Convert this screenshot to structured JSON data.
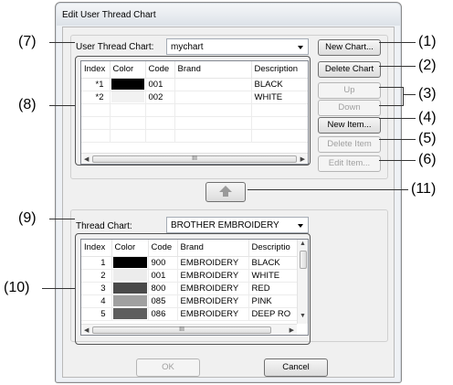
{
  "dialog": {
    "title": "Edit User Thread Chart",
    "user_chart": {
      "label": "User Thread Chart:",
      "selected": "mychart",
      "columns": [
        "Index",
        "Color",
        "Code",
        "Brand",
        "Description"
      ],
      "rows": [
        {
          "index": "*1",
          "color": "#000000",
          "code": "001",
          "brand": "",
          "description": "BLACK"
        },
        {
          "index": "*2",
          "color": "#f2f2f2",
          "code": "002",
          "brand": "",
          "description": "WHITE"
        }
      ]
    },
    "buttons": {
      "new_chart": "New Chart...",
      "delete_chart": "Delete Chart",
      "up": "Up",
      "down": "Down",
      "new_item": "New Item...",
      "delete_item": "Delete Item",
      "edit_item": "Edit Item...",
      "ok": "OK",
      "cancel": "Cancel"
    },
    "thread_chart": {
      "label": "Thread Chart:",
      "selected": "BROTHER EMBROIDERY",
      "columns": [
        "Index",
        "Color",
        "Code",
        "Brand",
        "Descriptio"
      ],
      "rows": [
        {
          "index": "1",
          "color": "#000000",
          "code": "900",
          "brand": "EMBROIDERY",
          "description": "BLACK"
        },
        {
          "index": "2",
          "color": "#ececec",
          "code": "001",
          "brand": "EMBROIDERY",
          "description": "WHITE"
        },
        {
          "index": "3",
          "color": "#4a4a4a",
          "code": "800",
          "brand": "EMBROIDERY",
          "description": "RED"
        },
        {
          "index": "4",
          "color": "#a0a0a0",
          "code": "085",
          "brand": "EMBROIDERY",
          "description": "PINK"
        },
        {
          "index": "5",
          "color": "#5e5e5e",
          "code": "086",
          "brand": "EMBROIDERY",
          "description": "DEEP RO"
        }
      ]
    },
    "scrollbar_grip": "III"
  },
  "callouts": [
    "(1)",
    "(2)",
    "(3)",
    "(4)",
    "(5)",
    "(6)",
    "(7)",
    "(8)",
    "(9)",
    "(10)",
    "(11)"
  ]
}
